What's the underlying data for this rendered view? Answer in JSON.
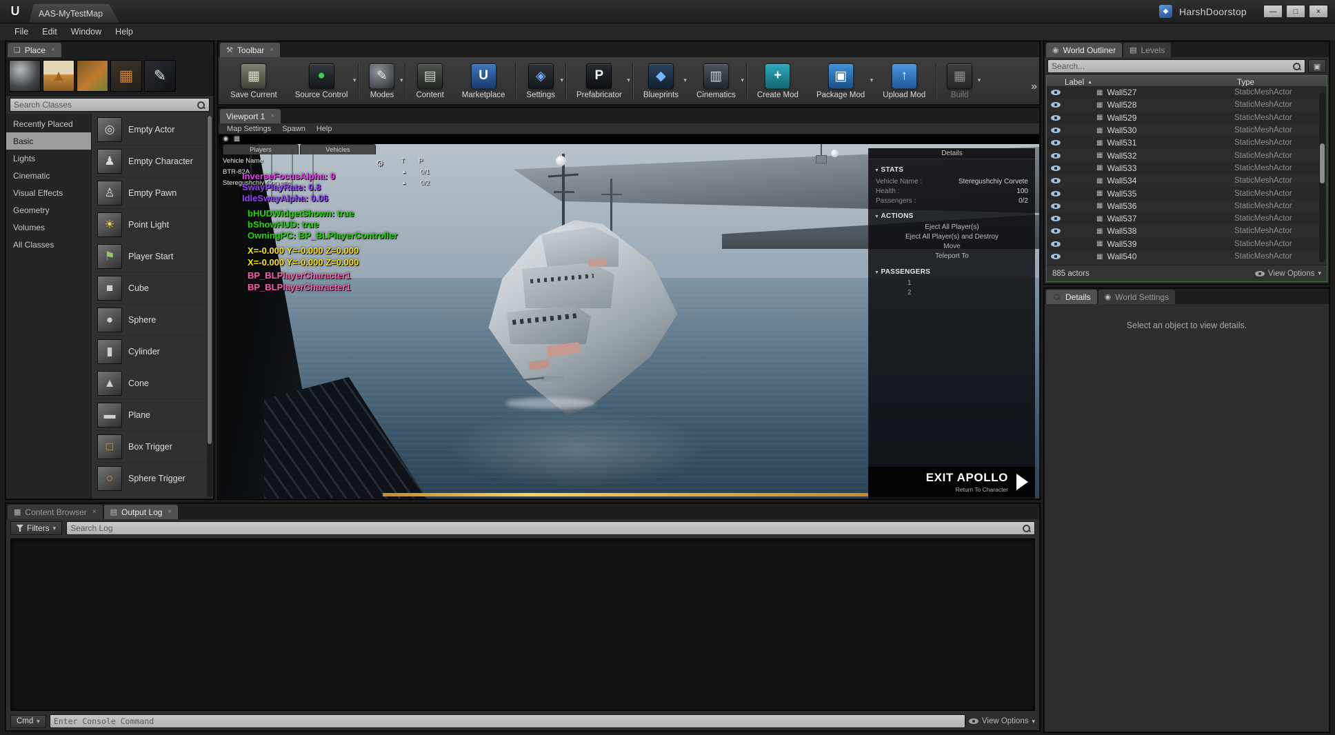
{
  "ui": {
    "close_glyph": "×",
    "caret_down": "▾",
    "sort_asc": "▲",
    "overflow_glyph": "»"
  },
  "title_bar": {
    "logo_glyph": "U",
    "app_tab": "AAS-MyTestMap",
    "user_name": "HarshDoorstop",
    "hd_logo_glyph": "◆",
    "controls": {
      "minimize": "—",
      "maximize": "□",
      "close": "×"
    }
  },
  "menu_bar": {
    "items": [
      "File",
      "Edit",
      "Window",
      "Help"
    ]
  },
  "place_panel": {
    "tab": "Place",
    "search_placeholder": "Search Classes",
    "strip_icons": [
      {
        "name": "sphere-asset-icon",
        "bg": "radial-gradient(circle at 35% 30%, #b9bcbe, #45484a 60%, #232527)",
        "glyph": "",
        "fg": ""
      },
      {
        "name": "terrain-asset-icon",
        "bg": "linear-gradient(180deg,#e3d6b4 45%,#c88d3e 46%,#8a5a22)",
        "glyph": "▲",
        "fg": "#a06020"
      },
      {
        "name": "foliage-asset-icon",
        "bg": "linear-gradient(135deg,#7c5a24,#c07c30 55%,#6f8136)",
        "glyph": "",
        "fg": ""
      },
      {
        "name": "brush-asset-icon",
        "bg": "linear-gradient(160deg,#3a342a,#241f18)",
        "glyph": "▦",
        "fg": "#d08030"
      },
      {
        "name": "pen-asset-icon",
        "bg": "linear-gradient(135deg,#2a2d33,#101215)",
        "glyph": "✎",
        "fg": "#e6e6e6"
      }
    ],
    "categories": [
      "Recently Placed",
      "Basic",
      "Lights",
      "Cinematic",
      "Visual Effects",
      "Geometry",
      "Volumes",
      "All Classes"
    ],
    "selected_category": "Basic",
    "items": [
      {
        "label": "Empty Actor",
        "glyph": "◎",
        "fg": "#d8d8d8"
      },
      {
        "label": "Empty Character",
        "glyph": "♟",
        "fg": "#d8d8d8"
      },
      {
        "label": "Empty Pawn",
        "glyph": "♙",
        "fg": "#d8d8d8"
      },
      {
        "label": "Point Light",
        "glyph": "☀",
        "fg": "#e8d44a"
      },
      {
        "label": "Player Start",
        "glyph": "⚑",
        "fg": "#9ac46a"
      },
      {
        "label": "Cube",
        "glyph": "■",
        "fg": "#cfcfcf"
      },
      {
        "label": "Sphere",
        "glyph": "●",
        "fg": "#cfcfcf"
      },
      {
        "label": "Cylinder",
        "glyph": "▮",
        "fg": "#cfcfcf"
      },
      {
        "label": "Cone",
        "glyph": "▲",
        "fg": "#cfcfcf"
      },
      {
        "label": "Plane",
        "glyph": "▬",
        "fg": "#cfcfcf"
      },
      {
        "label": "Box Trigger",
        "glyph": "□",
        "fg": "#d89a40"
      },
      {
        "label": "Sphere Trigger",
        "glyph": "○",
        "fg": "#d89a40"
      }
    ]
  },
  "toolbar": {
    "tab": "Toolbar",
    "buttons": [
      {
        "label": "Save Current",
        "icon": "save-icon",
        "glyph": "▦",
        "fg": "#ded9c2",
        "bg": "linear-gradient(180deg,#7d8274,#3e4338)",
        "caret": false,
        "group": 0,
        "disabled": false
      },
      {
        "label": "Source Control",
        "icon": "source-control-icon",
        "glyph": "●",
        "fg": "#3ecf52",
        "bg": "linear-gradient(180deg,#343a40,#14171a)",
        "caret": true,
        "group": 0,
        "disabled": false
      },
      {
        "label": "Modes",
        "icon": "modes-icon",
        "glyph": "✎",
        "fg": "#e4e4e4",
        "bg": "radial-gradient(circle at 35% 30%,#90959a,#2a2d31)",
        "caret": true,
        "group": 1,
        "disabled": false
      },
      {
        "label": "Content",
        "icon": "content-browser-icon",
        "glyph": "▤",
        "fg": "#cfd6cf",
        "bg": "linear-gradient(180deg,#4d544b,#23271f)",
        "caret": false,
        "group": 2,
        "disabled": false
      },
      {
        "label": "Marketplace",
        "icon": "marketplace-icon",
        "glyph": "U",
        "fg": "#ffffff",
        "bg": "linear-gradient(180deg,#3f76ba,#1a3c70)",
        "caret": false,
        "group": 2,
        "disabled": false
      },
      {
        "label": "Settings",
        "icon": "settings-icon",
        "glyph": "◈",
        "fg": "#6fb3ff",
        "bg": "linear-gradient(180deg,#2f343a,#14181c)",
        "caret": true,
        "group": 3,
        "disabled": false
      },
      {
        "label": "Prefabricator",
        "icon": "prefabricator-icon",
        "glyph": "P",
        "fg": "#f2f2f2",
        "bg": "linear-gradient(180deg,#262a30,#0e1013)",
        "caret": true,
        "group": 4,
        "disabled": false
      },
      {
        "label": "Blueprints",
        "icon": "blueprints-icon",
        "glyph": "◆",
        "fg": "#74b7ff",
        "bg": "linear-gradient(180deg,#2a4560,#122030)",
        "caret": true,
        "group": 5,
        "disabled": false
      },
      {
        "label": "Cinematics",
        "icon": "cinematics-icon",
        "glyph": "▥",
        "fg": "#cdd7df",
        "bg": "linear-gradient(180deg,#4c565e,#21262c)",
        "caret": true,
        "group": 5,
        "disabled": false
      },
      {
        "label": "Create Mod",
        "icon": "create-mod-icon",
        "glyph": "+",
        "fg": "#ffffff",
        "bg": "linear-gradient(180deg,#2fa9be,#136672)",
        "caret": false,
        "group": 6,
        "disabled": false
      },
      {
        "label": "Package Mod",
        "icon": "package-mod-icon",
        "glyph": "▣",
        "fg": "#ffffff",
        "bg": "linear-gradient(180deg,#3f93da,#1b4f88)",
        "caret": true,
        "group": 6,
        "disabled": false
      },
      {
        "label": "Upload Mod",
        "icon": "upload-mod-icon",
        "glyph": "↑",
        "fg": "#ffffff",
        "bg": "linear-gradient(180deg,#4a98e0,#20589a)",
        "caret": false,
        "group": 6,
        "disabled": false
      },
      {
        "label": "Build",
        "icon": "build-icon",
        "glyph": "▦",
        "fg": "#8b8b8b",
        "bg": "linear-gradient(180deg,#3f3f3f,#272727)",
        "caret": true,
        "group": 7,
        "disabled": true
      }
    ]
  },
  "viewport": {
    "tab": "Viewport 1",
    "menus": [
      "Map Settings",
      "Spawn",
      "Help"
    ],
    "corner_icons": [
      "◉",
      "▦"
    ],
    "debug": {
      "tabs": [
        "Players",
        "Vehicles"
      ],
      "gear_glyph": "⚙",
      "vehicle_list": {
        "header": "Vehicle Name",
        "col_t": "T",
        "col_p": "P",
        "rows": [
          {
            "name": "BTR-82A",
            "value": "0/1"
          },
          {
            "name": "Steregushchiy Corvette",
            "value": "0/2"
          }
        ]
      },
      "lines": [
        {
          "text": "InverseFocusAlpha: 0",
          "color": "#f03cf0"
        },
        {
          "text": "SwayPlayRate: 0.8",
          "color": "#9440ff"
        },
        {
          "text": "IdleSwayAlpha: 0.06",
          "color": "#9440ff"
        },
        {
          "text": "bHUDWidgetShown: true",
          "color": "#1edb00"
        },
        {
          "text": "bShowHUD: true",
          "color": "#1edb00"
        },
        {
          "text": "OwningPC: BP_BLPlayerController",
          "color": "#1edb00"
        },
        {
          "text": "X=-0.000 Y=-0.000 Z=0.000",
          "color": "#ffe600"
        },
        {
          "text": "X=-0.000 Y=-0.000 Z=0.000",
          "color": "#ffe600"
        },
        {
          "text": "BP_BLPlayerCharacter1",
          "color": "#ff5fae"
        },
        {
          "text": "BP_BLPlayerCharacter1",
          "color": "#ff5fae"
        }
      ]
    },
    "details_overlay": {
      "title": "Details",
      "sections": {
        "stats": "STATS",
        "actions": "ACTIONS",
        "passengers": "PASSENGERS"
      },
      "stats": [
        {
          "label": "Vehicle Name :",
          "value": "Steregushchiy Corvete"
        },
        {
          "label": "Health :",
          "value": "100"
        },
        {
          "label": "Passengers :",
          "value": "0/2"
        }
      ],
      "actions": [
        "Eject All Player(s)",
        "Eject All Player(s) and Destroy",
        "Move",
        "Teleport To"
      ],
      "passengers": [
        "1",
        "2"
      ]
    },
    "exit_button": {
      "label": "EXIT APOLLO",
      "sublabel": "Return To Character"
    }
  },
  "world_outliner": {
    "tabs": [
      {
        "label": "World Outliner",
        "icon_glyph": "◉"
      },
      {
        "label": "Levels",
        "icon_glyph": "▤"
      }
    ],
    "search_placeholder": "Search...",
    "settings_button_glyph": "▣",
    "columns": {
      "label": "Label",
      "type": "Type"
    },
    "rows": [
      {
        "label": "Wall527",
        "type": "StaticMeshActor"
      },
      {
        "label": "Wall528",
        "type": "StaticMeshActor"
      },
      {
        "label": "Wall529",
        "type": "StaticMeshActor"
      },
      {
        "label": "Wall530",
        "type": "StaticMeshActor"
      },
      {
        "label": "Wall531",
        "type": "StaticMeshActor"
      },
      {
        "label": "Wall532",
        "type": "StaticMeshActor"
      },
      {
        "label": "Wall533",
        "type": "StaticMeshActor"
      },
      {
        "label": "Wall534",
        "type": "StaticMeshActor"
      },
      {
        "label": "Wall535",
        "type": "StaticMeshActor"
      },
      {
        "label": "Wall536",
        "type": "StaticMeshActor"
      },
      {
        "label": "Wall537",
        "type": "StaticMeshActor"
      },
      {
        "label": "Wall538",
        "type": "StaticMeshActor"
      },
      {
        "label": "Wall539",
        "type": "StaticMeshActor"
      },
      {
        "label": "Wall540",
        "type": "StaticMeshActor"
      }
    ],
    "row_icon_glyph": "▦",
    "footer": {
      "count": "885 actors",
      "view_options": "View Options"
    }
  },
  "details_panel": {
    "tabs": [
      "Details",
      "World Settings"
    ],
    "empty_text": "Select an object to view details."
  },
  "bottom_panel": {
    "tabs": [
      "Content Browser",
      "Output Log"
    ],
    "filters_label": "Filters",
    "search_placeholder": "Search Log",
    "cmd_label": "Cmd",
    "console_placeholder": "Enter Console Command",
    "view_options": "View Options"
  }
}
